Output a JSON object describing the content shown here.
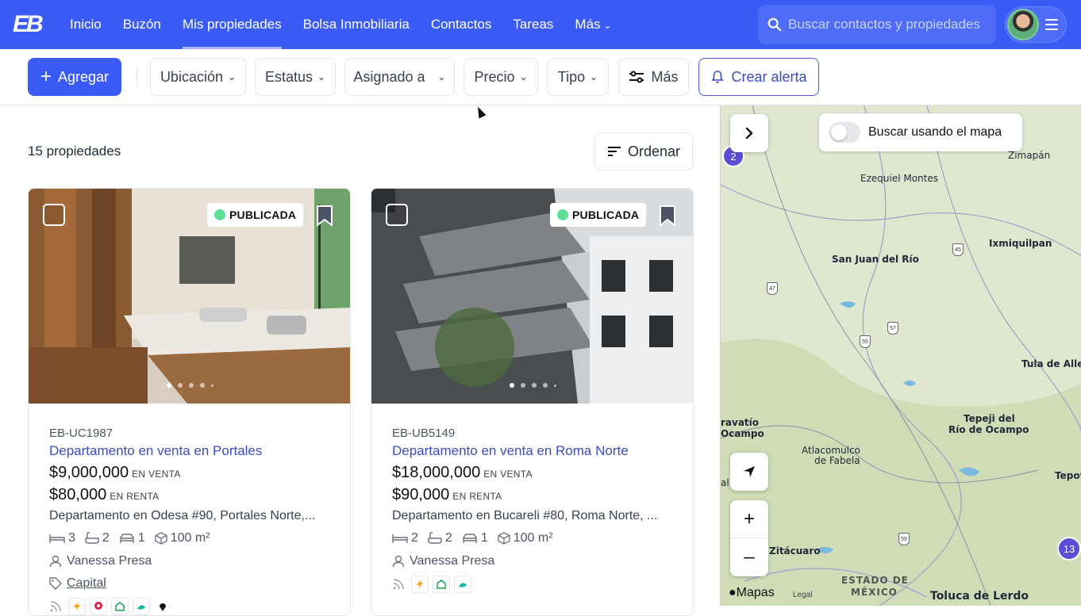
{
  "app": {
    "logo_text": "EB"
  },
  "nav": {
    "links": [
      {
        "label": "Inicio"
      },
      {
        "label": "Buzón"
      },
      {
        "label": "Mis propiedades",
        "active": true
      },
      {
        "label": "Bolsa Inmobiliaria"
      },
      {
        "label": "Contactos"
      },
      {
        "label": "Tareas"
      },
      {
        "label": "Más"
      }
    ],
    "search_placeholder": "Buscar contactos y propiedades"
  },
  "filters": {
    "add_label": "Agregar",
    "ubicacion": "Ubicación",
    "estatus": "Estatus",
    "asignado": "Asignado a",
    "precio": "Precio",
    "tipo": "Tipo",
    "mas": "Más",
    "alert": "Crear alerta"
  },
  "list": {
    "count": "15 propiedades",
    "sort_label": "Ordenar"
  },
  "cards": [
    {
      "status": "PUBLICADA",
      "ref": "EB-UC1987",
      "title": "Departamento en venta en Portales",
      "sale_price": "$9,000,000",
      "sale_kind": "EN VENTA",
      "rent_price": "$80,000",
      "rent_kind": "EN RENTA",
      "address": "Departamento en Odesa #90, Portales Norte,...",
      "bedrooms": "3",
      "bathrooms": "2",
      "parking": "1",
      "area": "100 m²",
      "agent": "Vanessa Presa",
      "tag": "Capital"
    },
    {
      "status": "PUBLICADA",
      "ref": "EB-UB5149",
      "title": "Departamento en venta en Roma Norte",
      "sale_price": "$18,000,000",
      "sale_kind": "EN VENTA",
      "rent_price": "$90,000",
      "rent_kind": "EN RENTA",
      "address": "Departamento en Bucareli #80, Roma Norte, ...",
      "bedrooms": "2",
      "bathrooms": "2",
      "parking": "1",
      "area": "100 m²",
      "agent": "Vanessa Presa"
    }
  ],
  "map": {
    "toggle_label": "Buscar usando el mapa",
    "clusters": [
      "2",
      "13"
    ],
    "places": [
      "Zimapán",
      "Ezequiel Montes",
      "Ixmiquilpan",
      "San Juan del Río",
      "Tula de Allende",
      "Tepeji del",
      "Río de Ocampo",
      "Atlacomulco",
      "de Fabela",
      "ravatío",
      "Ocampo",
      "Tepot",
      "Zitácuaro",
      "ESTADO DE",
      "MÉXICO",
      "Toluca de Lerdo",
      "al"
    ],
    "highway_shields": [
      "47",
      "45",
      "57",
      "55",
      "55"
    ],
    "attribution": "Mapas",
    "legal": "Legal"
  },
  "colors": {
    "brand": "#3b5bf6",
    "link": "#3b4cc0",
    "published_dot": "#5ee09a",
    "cluster": "#5b4fd6"
  }
}
